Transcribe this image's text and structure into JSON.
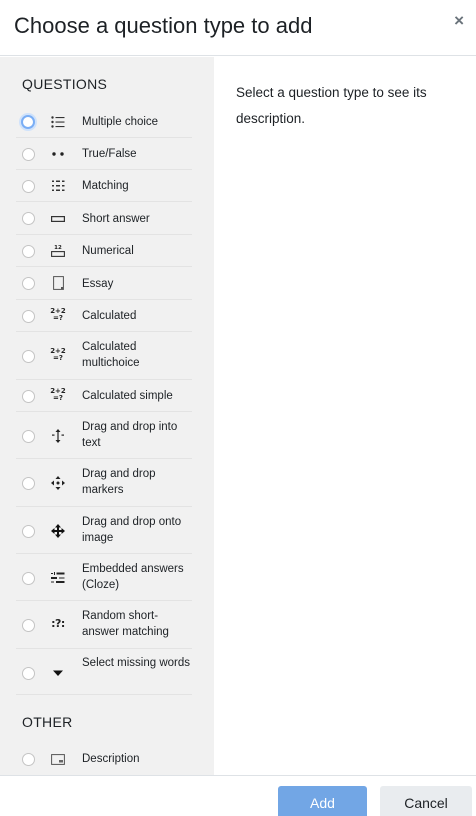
{
  "dialog": {
    "title": "Choose a question type to add",
    "close_label": "×"
  },
  "sidebar": {
    "questions_heading": "QUESTIONS",
    "other_heading": "OTHER",
    "questions": [
      {
        "label": "Multiple choice",
        "icon": "multichoice-icon",
        "selected": true
      },
      {
        "label": "True/False",
        "icon": "truefalse-icon"
      },
      {
        "label": "Matching",
        "icon": "matching-icon"
      },
      {
        "label": "Short answer",
        "icon": "shortanswer-icon"
      },
      {
        "label": "Numerical",
        "icon": "numerical-icon",
        "icon_text": "12"
      },
      {
        "label": "Essay",
        "icon": "essay-icon"
      },
      {
        "label": "Calculated",
        "icon": "calculated-icon",
        "icon_text_top": "2+2",
        "icon_text_bottom": "=?"
      },
      {
        "label": "Calculated multichoice",
        "icon": "calculated-multichoice-icon",
        "icon_text_top": "2+2",
        "icon_text_bottom": "=?"
      },
      {
        "label": "Calculated simple",
        "icon": "calculated-simple-icon",
        "icon_text_top": "2+2",
        "icon_text_bottom": "=?"
      },
      {
        "label": "Drag and drop into text",
        "icon": "drag-drop-text-icon"
      },
      {
        "label": "Drag and drop markers",
        "icon": "drag-drop-markers-icon"
      },
      {
        "label": "Drag and drop onto image",
        "icon": "drag-drop-image-icon"
      },
      {
        "label": "Embedded answers (Cloze)",
        "icon": "cloze-icon"
      },
      {
        "label": "Random short-answer matching",
        "icon": "random-matching-icon",
        "icon_text": ":?:"
      },
      {
        "label": "Select missing words",
        "icon": "select-missing-words-icon"
      }
    ],
    "other": [
      {
        "label": "Description",
        "icon": "description-icon"
      }
    ]
  },
  "description_placeholder": "Select a question type to see its description.",
  "footer": {
    "add_label": "Add",
    "cancel_label": "Cancel"
  },
  "colors": {
    "primary_button": "#72a6e5",
    "sidebar_bg": "#f1f1f1",
    "radio_focus": "#7aaef5"
  }
}
